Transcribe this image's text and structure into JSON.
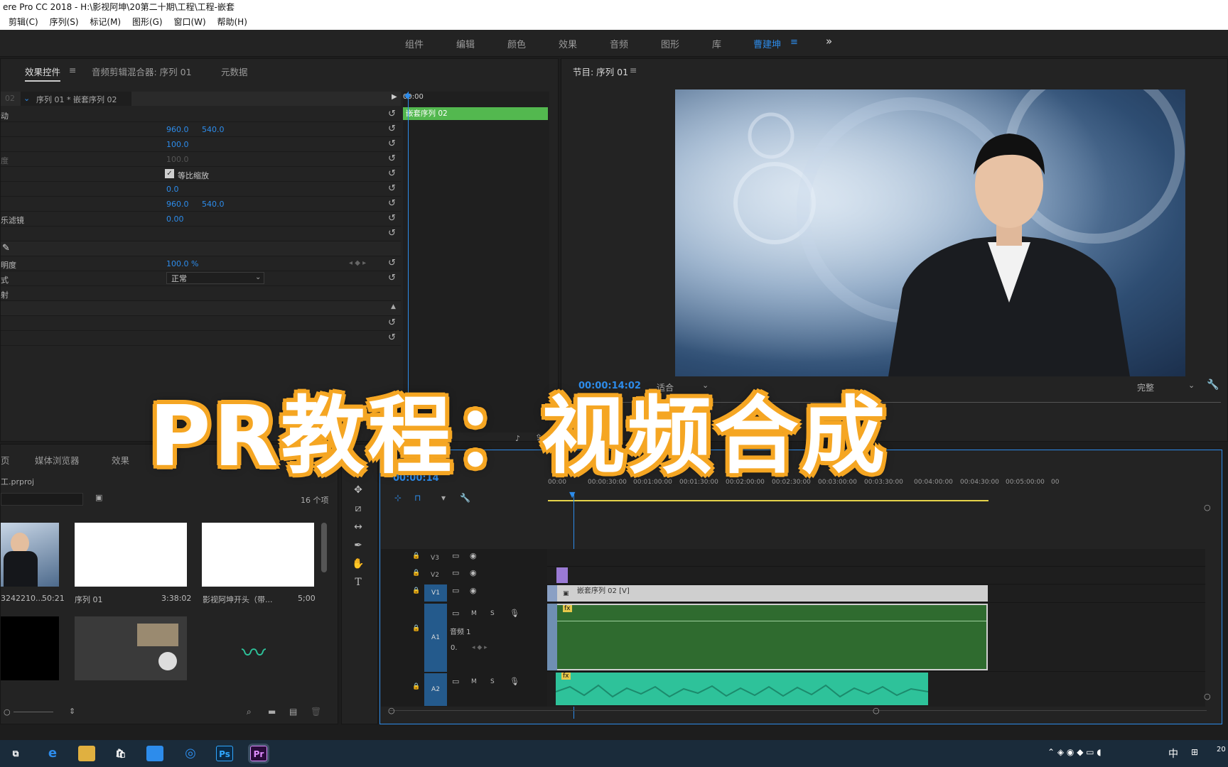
{
  "window": {
    "title": "ere Pro CC 2018 - H:\\影视阿坤\\20第二十期\\工程\\工程-嵌套"
  },
  "menu": [
    "剪辑(C)",
    "序列(S)",
    "标记(M)",
    "图形(G)",
    "窗口(W)",
    "帮助(H)"
  ],
  "workspaces": [
    "组件",
    "编辑",
    "颜色",
    "效果",
    "音频",
    "图形",
    "库",
    "曹建坤",
    "≡",
    "»"
  ],
  "effect_panel": {
    "tabs": [
      "效果控件",
      "≡",
      "音频剪辑混合器: 序列 01",
      "元数据"
    ],
    "source": "02",
    "seq_link": "序列 01 * 嵌套序列 02",
    "timecode_top": "00:00",
    "clip_name": "嵌套序列 02",
    "rows": [
      {
        "label": "动",
        "v1": "",
        "v2": ""
      },
      {
        "label": "",
        "v1": "960.0",
        "v2": "540.0"
      },
      {
        "label": "",
        "v1": "100.0",
        "v2": ""
      },
      {
        "label": "度",
        "v1": "100.0",
        "v2": ""
      },
      {
        "label": "",
        "v1": "等比缩放",
        "v2": ""
      },
      {
        "label": "",
        "v1": "0.0",
        "v2": ""
      },
      {
        "label": "",
        "v1": "960.0",
        "v2": "540.0"
      },
      {
        "label": "乐滤镜",
        "v1": "0.00",
        "v2": ""
      },
      {
        "label": "",
        "v1": "",
        "v2": ""
      },
      {
        "label": "",
        "v1": "",
        "v2": ""
      },
      {
        "label": "明度",
        "v1": "100.0 %",
        "v2": ""
      },
      {
        "label": "式",
        "v1": "正常",
        "v2": ""
      },
      {
        "label": "射",
        "v1": "",
        "v2": ""
      }
    ]
  },
  "program": {
    "title": "节目: 序列 01",
    "menu_icon": "≡",
    "timecode": "00:00:14:02",
    "fit": "适合",
    "quality": "完整"
  },
  "project": {
    "tabs": [
      "页",
      "媒体浏览器",
      "效果"
    ],
    "file": "工.prproj",
    "count": "16 个项",
    "items": [
      {
        "name": "3242210...",
        "dur": "50:21"
      },
      {
        "name": "序列 01",
        "dur": "3:38:02"
      },
      {
        "name": "影视阿坤开头（带...",
        "dur": "5;00"
      },
      {
        "name": "",
        "dur": ""
      },
      {
        "name": "",
        "dur": ""
      },
      {
        "name": "",
        "dur": ""
      }
    ]
  },
  "timeline": {
    "timecode": "00:00:14",
    "ruler": [
      "00:00",
      "00:00:30:00",
      "00:01:00:00",
      "00:01:30:00",
      "00:02:00:00",
      "00:02:30:00",
      "00:03:00:00",
      "00:03:30:00",
      "00:04:00:00",
      "00:04:30:00",
      "00:05:00:00",
      "00"
    ],
    "tracks": [
      "V3",
      "V2",
      "V1",
      "A1",
      "A2"
    ],
    "a1_name": "音频 1",
    "clip_v1": "嵌套序列 02 [V]",
    "fx": "fx"
  },
  "overlay_title": "PR教程：视频合成",
  "taskbar": {
    "ime": "中",
    "apps": [
      "Ps",
      "Pr"
    ]
  },
  "colors": {
    "accent": "#2d8ceb",
    "clip_green": "#53b84f",
    "audio_dark": "#2f6b2f",
    "audio_teal": "#2ec29a",
    "title_orange": "#f5a623"
  }
}
